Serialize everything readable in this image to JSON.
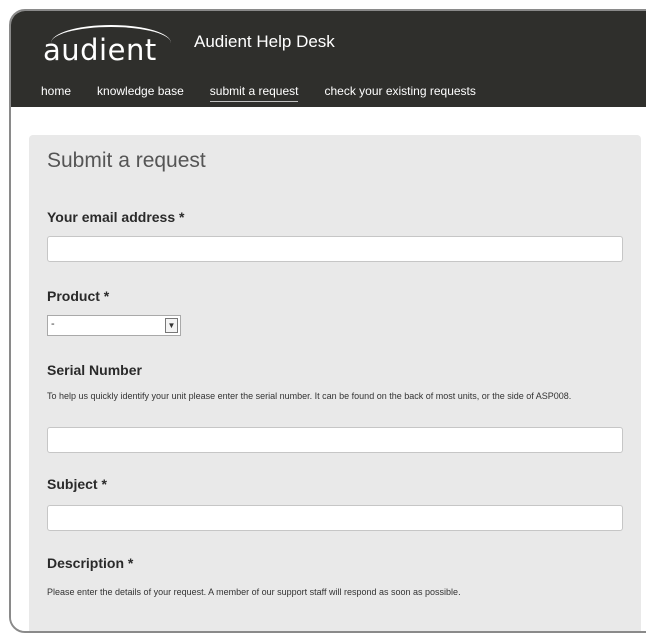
{
  "brand": {
    "logo_text": "audient",
    "site_title": "Audient Help Desk"
  },
  "nav": {
    "items": [
      {
        "label": "home"
      },
      {
        "label": "knowledge base"
      },
      {
        "label": "submit a request"
      },
      {
        "label": "check your existing requests"
      }
    ],
    "active_index": 2
  },
  "form": {
    "title": "Submit a request",
    "email_label": "Your email address *",
    "product_label": "Product *",
    "product_selected": "-",
    "serial_label": "Serial Number",
    "serial_help": "To help us quickly identify your unit please enter the serial number. It can be found on the back of most units, or the side of ASP008.",
    "subject_label": "Subject *",
    "description_label": "Description *",
    "description_help": "Please enter the details of your request. A member of our support staff will respond as soon as possible."
  },
  "icons": {
    "select_arrow": "chevron-down-icon"
  },
  "colors": {
    "topbar_bg": "#2f2f2c",
    "panel_bg": "#e9e9e9"
  }
}
